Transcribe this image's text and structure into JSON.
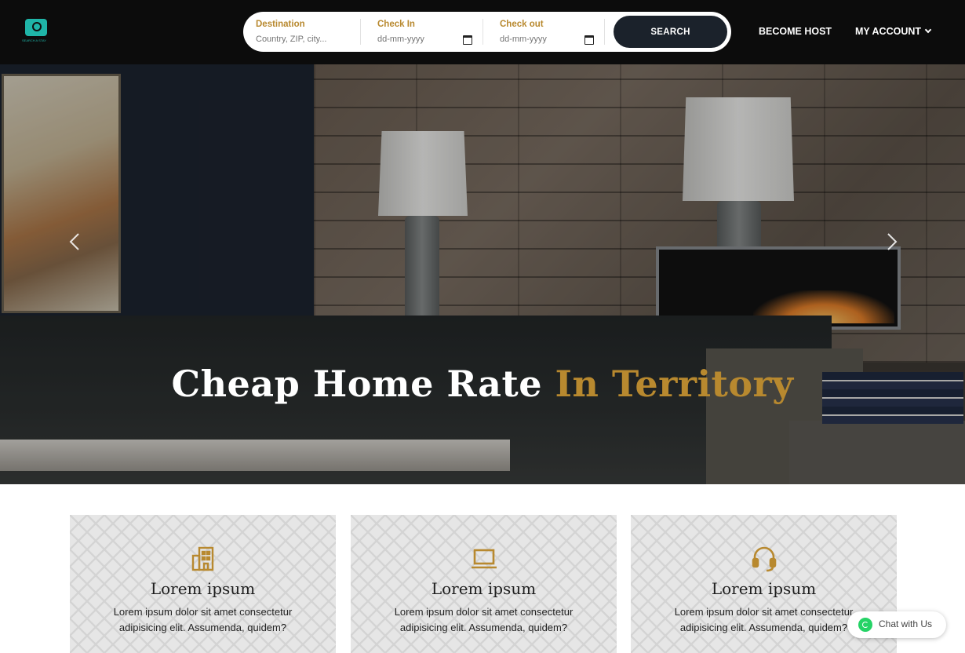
{
  "header": {
    "logo_text": "SEARCH A STAY",
    "nav": {
      "become_host": "BECOME HOST",
      "my_account": "MY ACCOUNT"
    }
  },
  "search": {
    "destination": {
      "label": "Destination",
      "placeholder": "Country, ZIP, city..."
    },
    "check_in": {
      "label": "Check In",
      "placeholder": "dd-mm-yyyy"
    },
    "check_out": {
      "label": "Check out",
      "placeholder": "dd-mm-yyyy"
    },
    "button_label": "SEARCH"
  },
  "hero": {
    "heading": "Cheap Home Rate",
    "heading_accent": "In Territory",
    "accent_color": "#b8892f"
  },
  "features": [
    {
      "icon": "building-icon",
      "title": "Lorem ipsum",
      "text": "Lorem ipsum dolor sit amet consectetur adipisicing elit. Assumenda, quidem?"
    },
    {
      "icon": "laptop-icon",
      "title": "Lorem ipsum",
      "text": "Lorem ipsum dolor sit amet consectetur adipisicing elit. Assumenda, quidem?"
    },
    {
      "icon": "headset-icon",
      "title": "Lorem ipsum",
      "text": "Lorem ipsum dolor sit amet consectetur adipisicing elit. Assumenda, quidem?"
    }
  ],
  "chat": {
    "label": "Chat with Us"
  },
  "colors": {
    "accent": "#b8892f",
    "search_button": "#1b222b",
    "whatsapp": "#25d366"
  }
}
